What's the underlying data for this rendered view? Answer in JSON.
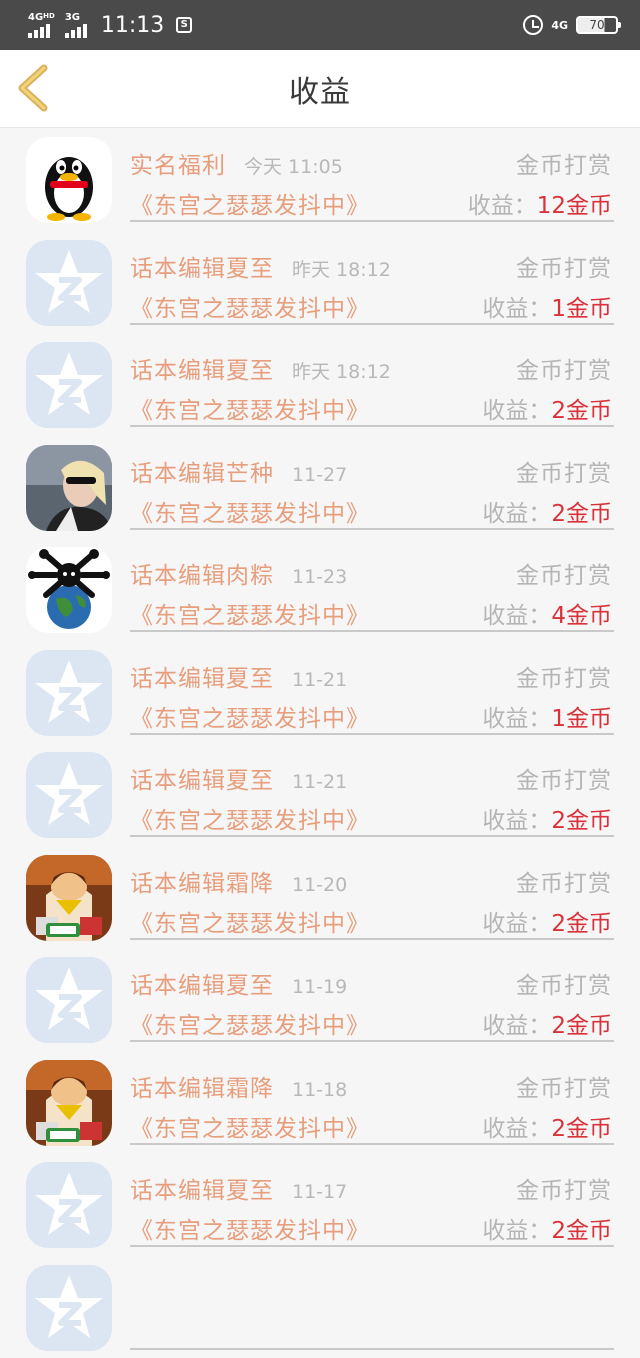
{
  "status_bar": {
    "network_left_1": "4G",
    "network_left_1_sup": "HD",
    "network_left_2": "3G",
    "time": "11:13",
    "network_right": "4G",
    "battery": "70"
  },
  "header": {
    "title": "收益"
  },
  "list": [
    {
      "name": "实名福利",
      "time": "今天 11:05",
      "type": "金币打赏",
      "book": "《东宫之瑟瑟发抖中》",
      "earn_label": "收益：",
      "earn_value": "12金币",
      "avatar": "qq-penguin"
    },
    {
      "name": "话本编辑夏至",
      "time": "昨天 18:12",
      "type": "金币打赏",
      "book": "《东宫之瑟瑟发抖中》",
      "earn_label": "收益：",
      "earn_value": "1金币",
      "avatar": "default-star"
    },
    {
      "name": "话本编辑夏至",
      "time": "昨天 18:12",
      "type": "金币打赏",
      "book": "《东宫之瑟瑟发抖中》",
      "earn_label": "收益：",
      "earn_value": "2金币",
      "avatar": "default-star"
    },
    {
      "name": "话本编辑芒种",
      "time": "11-27",
      "type": "金币打赏",
      "book": "《东宫之瑟瑟发抖中》",
      "earn_label": "收益：",
      "earn_value": "2金币",
      "avatar": "photo-woman"
    },
    {
      "name": "话本编辑肉粽",
      "time": "11-23",
      "type": "金币打赏",
      "book": "《东宫之瑟瑟发抖中》",
      "earn_label": "收益：",
      "earn_value": "4金币",
      "avatar": "skull-globe"
    },
    {
      "name": "话本编辑夏至",
      "time": "11-21",
      "type": "金币打赏",
      "book": "《东宫之瑟瑟发抖中》",
      "earn_label": "收益：",
      "earn_value": "1金币",
      "avatar": "default-star"
    },
    {
      "name": "话本编辑夏至",
      "time": "11-21",
      "type": "金币打赏",
      "book": "《东宫之瑟瑟发抖中》",
      "earn_label": "收益：",
      "earn_value": "2金币",
      "avatar": "default-star"
    },
    {
      "name": "话本编辑霜降",
      "time": "11-20",
      "type": "金币打赏",
      "book": "《东宫之瑟瑟发抖中》",
      "earn_label": "收益：",
      "earn_value": "2金币",
      "avatar": "game-character"
    },
    {
      "name": "话本编辑夏至",
      "time": "11-19",
      "type": "金币打赏",
      "book": "《东宫之瑟瑟发抖中》",
      "earn_label": "收益：",
      "earn_value": "2金币",
      "avatar": "default-star"
    },
    {
      "name": "话本编辑霜降",
      "time": "11-18",
      "type": "金币打赏",
      "book": "《东宫之瑟瑟发抖中》",
      "earn_label": "收益：",
      "earn_value": "2金币",
      "avatar": "game-character"
    },
    {
      "name": "话本编辑夏至",
      "time": "11-17",
      "type": "金币打赏",
      "book": "《东宫之瑟瑟发抖中》",
      "earn_label": "收益：",
      "earn_value": "2金币",
      "avatar": "default-star"
    },
    {
      "name": "",
      "time": "",
      "type": "",
      "book": "",
      "earn_label": "",
      "earn_value": "",
      "avatar": "default-star"
    }
  ]
}
